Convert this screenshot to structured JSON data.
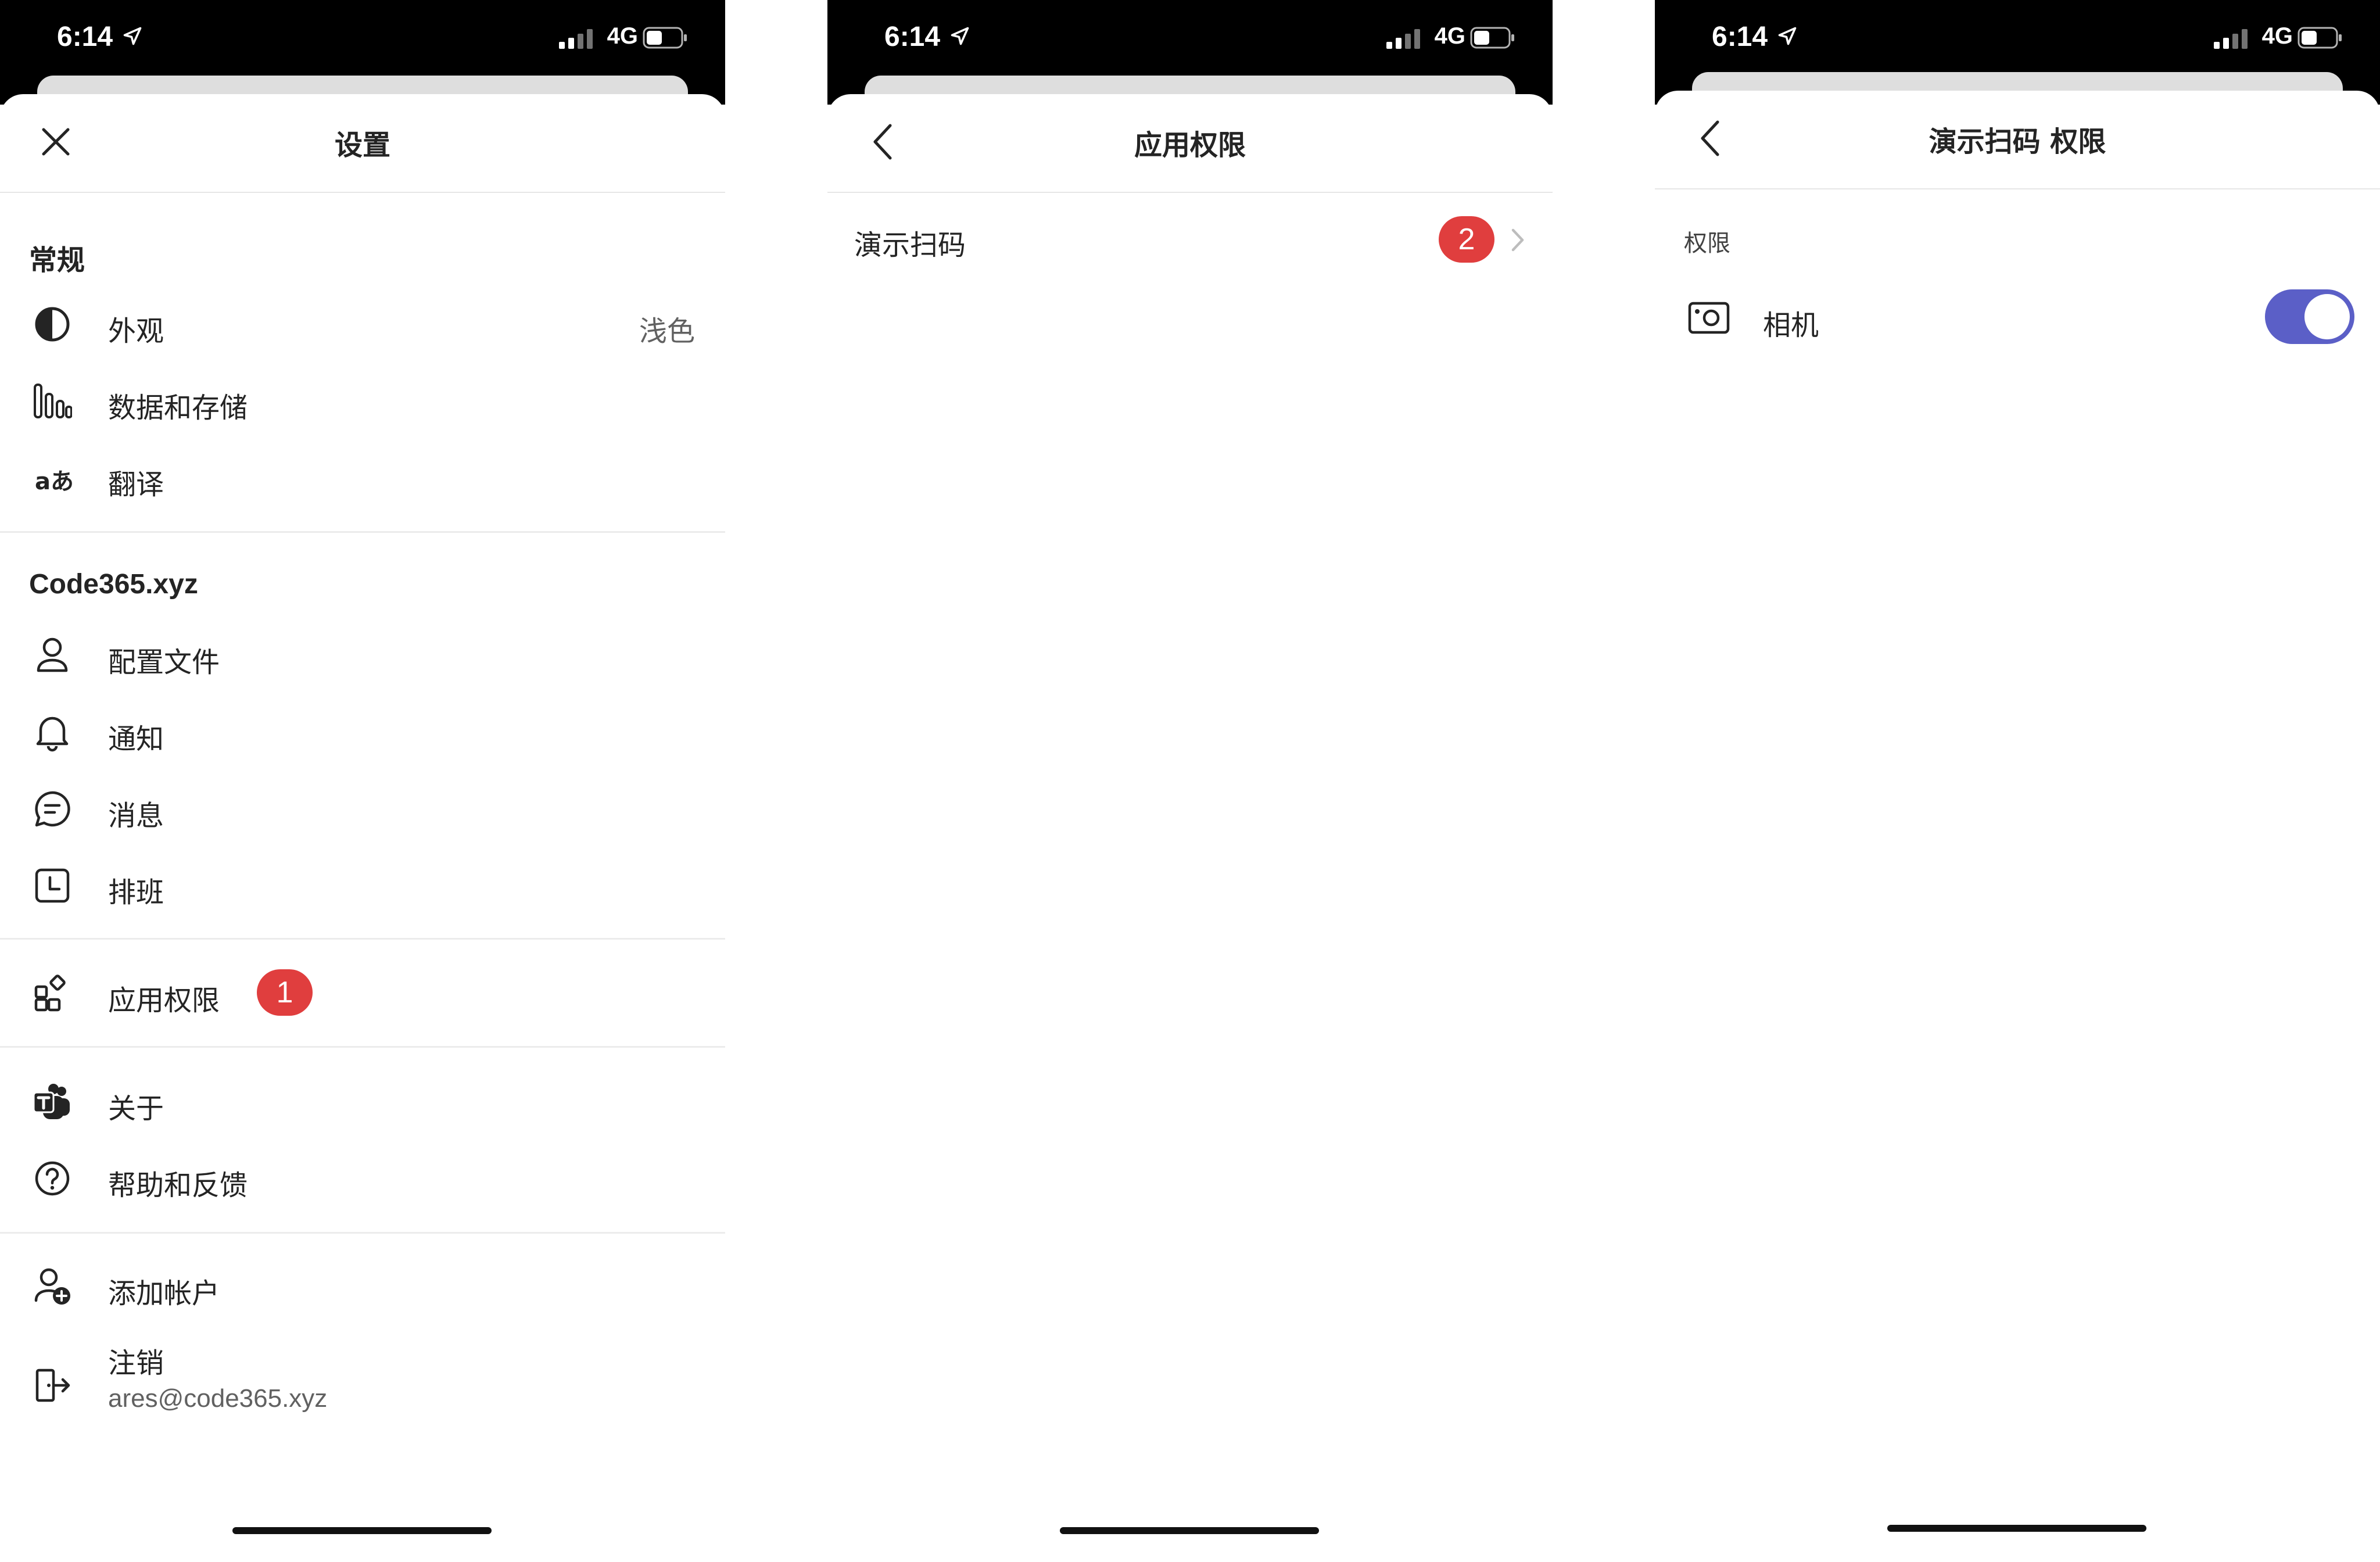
{
  "status_bar": {
    "time": "6:14",
    "network": "4G"
  },
  "screens": [
    {
      "title": "设置",
      "sections": {
        "general": {
          "heading": "常规",
          "items": [
            {
              "label": "外观",
              "value": "浅色",
              "icon": "contrast-icon"
            },
            {
              "label": "数据和存储",
              "icon": "bar-chart-icon"
            },
            {
              "label": "翻译",
              "icon": "translate-icon"
            }
          ]
        },
        "org": {
          "heading": "Code365.xyz",
          "items": [
            {
              "label": "配置文件",
              "icon": "person-icon"
            },
            {
              "label": "通知",
              "icon": "bell-icon"
            },
            {
              "label": "消息",
              "icon": "chat-icon"
            },
            {
              "label": "排班",
              "icon": "shifts-icon"
            }
          ]
        },
        "permissions": {
          "label": "应用权限",
          "badge": "1",
          "icon": "apps-icon"
        },
        "misc": {
          "items": [
            {
              "label": "关于",
              "icon": "teams-logo-icon"
            },
            {
              "label": "帮助和反馈",
              "icon": "help-icon"
            }
          ]
        },
        "account": {
          "add_label": "添加帐户",
          "signout_label": "注销",
          "email": "ares@code365.xyz"
        }
      }
    },
    {
      "title": "应用权限",
      "items": [
        {
          "label": "演示扫码",
          "badge": "2"
        }
      ]
    },
    {
      "title": "演示扫码 权限",
      "section_label": "权限",
      "items": [
        {
          "label": "相机",
          "enabled": true,
          "icon": "camera-icon"
        }
      ]
    }
  ],
  "colors": {
    "accent": "#5b5fc7",
    "badge": "#e03e3e",
    "statusbar": "#000000"
  }
}
